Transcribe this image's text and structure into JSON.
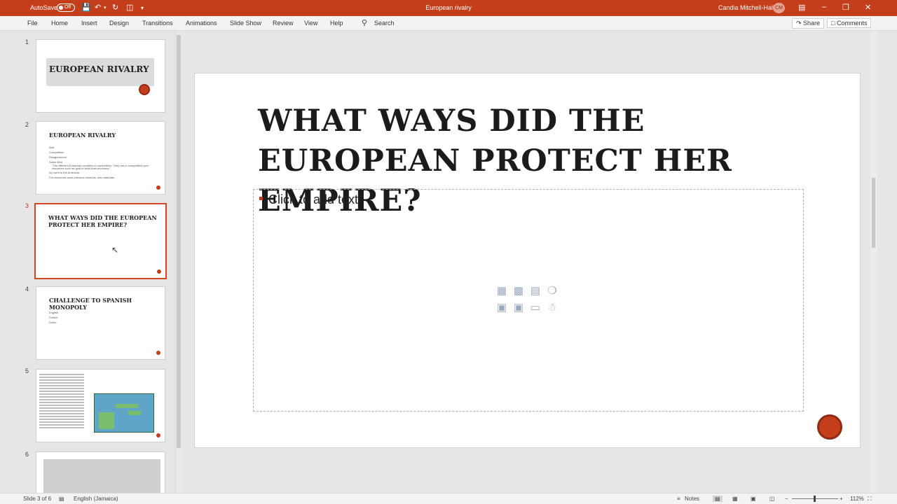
{
  "titlebar": {
    "autosave_label": "AutoSave",
    "autosave_state": "Off",
    "document_title": "European rivalry",
    "user_name": "Candia Mitchell-Hall",
    "user_initials": "CM"
  },
  "ribbon": {
    "tabs": [
      "File",
      "Home",
      "Insert",
      "Design",
      "Transitions",
      "Animations",
      "Slide Show",
      "Review",
      "View",
      "Help"
    ],
    "search_label": "Search",
    "share_label": "Share",
    "comments_label": "Comments"
  },
  "thumbnails": [
    {
      "number": "1",
      "title": "European Rivalry"
    },
    {
      "number": "2",
      "title": "European Rivalry",
      "bullets": [
        "War",
        "Competition",
        "Disagreement",
        "Same field",
        "“The different European countries in competition. They are in competition over resources such as gold to build their economy.”",
        "Ivy went to the Americas",
        "For resources such precious minerals, raw materials."
      ]
    },
    {
      "number": "3",
      "title": "What ways did the European protect her empire?"
    },
    {
      "number": "4",
      "title": "Challenge to Spanish monopoly",
      "bullets": [
        "English",
        "French",
        "Dutch"
      ]
    },
    {
      "number": "5"
    },
    {
      "number": "6"
    }
  ],
  "slide": {
    "title": "WHAT WAYS DID THE EUROPEAN PROTECT HER EMPIRE?",
    "content_placeholder": "Click to add text"
  },
  "statusbar": {
    "slide_position": "Slide 3 of 6",
    "language": "English (Jamaica)",
    "notes_label": "Notes",
    "zoom_level": "112%"
  },
  "colors": {
    "accent": "#c43e1c",
    "selection": "#d24726"
  }
}
